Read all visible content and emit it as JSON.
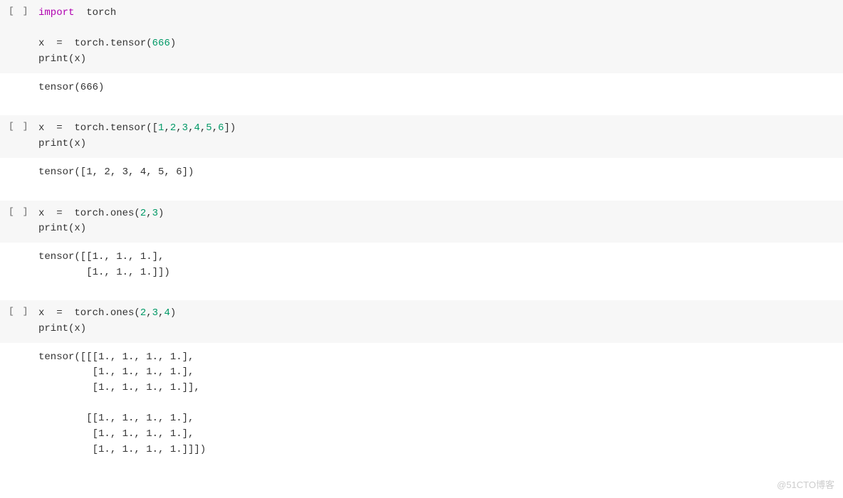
{
  "prompt_label": "[ ]",
  "watermark": "@51CTO博客",
  "cells": [
    {
      "code_tokens": [
        [
          {
            "t": "import",
            "c": "kw-import"
          },
          {
            "t": "  torch",
            "c": ""
          }
        ],
        [
          {
            "t": "",
            "c": ""
          }
        ],
        [
          {
            "t": "x  =  torch.tensor(",
            "c": ""
          },
          {
            "t": "666",
            "c": "num"
          },
          {
            "t": ")",
            "c": ""
          }
        ],
        [
          {
            "t": "print(x)",
            "c": ""
          }
        ]
      ],
      "output": "tensor(666)"
    },
    {
      "code_tokens": [
        [
          {
            "t": "x  =  torch.tensor([",
            "c": ""
          },
          {
            "t": "1",
            "c": "num"
          },
          {
            "t": ",",
            "c": ""
          },
          {
            "t": "2",
            "c": "num"
          },
          {
            "t": ",",
            "c": ""
          },
          {
            "t": "3",
            "c": "num"
          },
          {
            "t": ",",
            "c": ""
          },
          {
            "t": "4",
            "c": "num"
          },
          {
            "t": ",",
            "c": ""
          },
          {
            "t": "5",
            "c": "num"
          },
          {
            "t": ",",
            "c": ""
          },
          {
            "t": "6",
            "c": "num"
          },
          {
            "t": "])",
            "c": ""
          }
        ],
        [
          {
            "t": "print(x)",
            "c": ""
          }
        ]
      ],
      "output": "tensor([1, 2, 3, 4, 5, 6])"
    },
    {
      "code_tokens": [
        [
          {
            "t": "x  =  torch.ones(",
            "c": ""
          },
          {
            "t": "2",
            "c": "num"
          },
          {
            "t": ",",
            "c": ""
          },
          {
            "t": "3",
            "c": "num"
          },
          {
            "t": ")",
            "c": ""
          }
        ],
        [
          {
            "t": "print(x)",
            "c": ""
          }
        ]
      ],
      "output": "tensor([[1., 1., 1.],\n        [1., 1., 1.]])"
    },
    {
      "code_tokens": [
        [
          {
            "t": "x  =  torch.ones(",
            "c": ""
          },
          {
            "t": "2",
            "c": "num"
          },
          {
            "t": ",",
            "c": ""
          },
          {
            "t": "3",
            "c": "num"
          },
          {
            "t": ",",
            "c": ""
          },
          {
            "t": "4",
            "c": "num"
          },
          {
            "t": ")",
            "c": ""
          }
        ],
        [
          {
            "t": "print(x)",
            "c": ""
          }
        ]
      ],
      "output": "tensor([[[1., 1., 1., 1.],\n         [1., 1., 1., 1.],\n         [1., 1., 1., 1.]],\n\n        [[1., 1., 1., 1.],\n         [1., 1., 1., 1.],\n         [1., 1., 1., 1.]]])"
    }
  ]
}
